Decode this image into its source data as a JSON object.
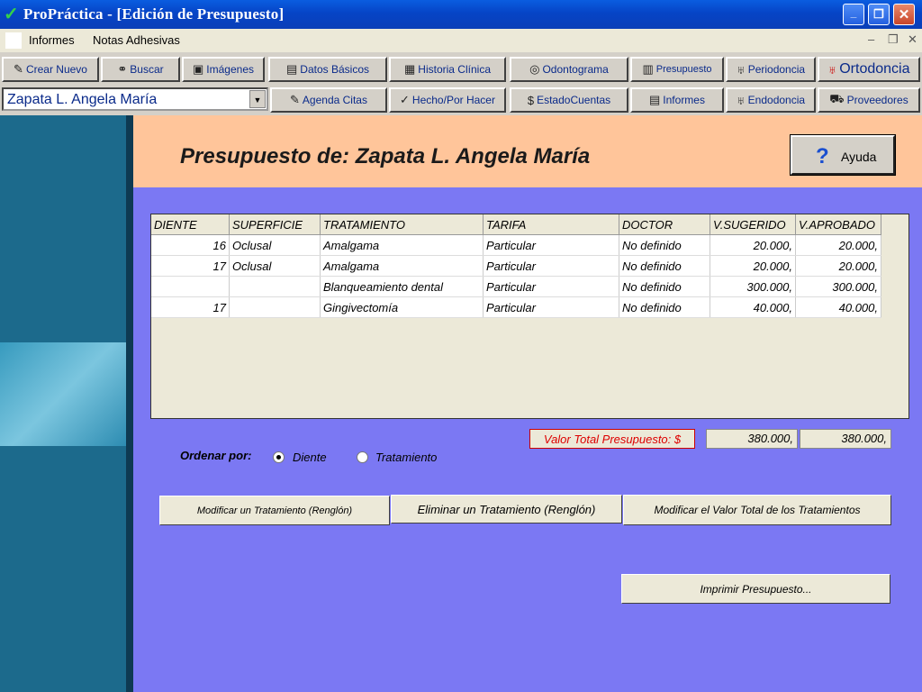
{
  "window": {
    "title": "ProPráctica - [Edición de Presupuesto]"
  },
  "menu": {
    "items": [
      "Informes",
      "Notas Adhesivas"
    ]
  },
  "toolbar": {
    "row1": [
      "Crear Nuevo",
      "Buscar",
      "Imágenes",
      "Datos Básicos",
      "Historia Clínica",
      "Odontograma",
      "Presupuesto",
      "Periodoncia",
      "Ortodoncia"
    ],
    "row2": [
      "Agenda Citas",
      "Hecho/Por Hacer",
      "EstadoCuentas",
      "Informes",
      "Endodoncia",
      "Proveedores"
    ],
    "patient_selected": "Zapata L. Angela María"
  },
  "header": {
    "title": "Presupuesto de: Zapata L. Angela María",
    "help_label": "Ayuda"
  },
  "table": {
    "columns": [
      "DIENTE",
      "SUPERFICIE",
      "TRATAMIENTO",
      "TARIFA",
      "DOCTOR",
      "V.SUGERIDO",
      "V.APROBADO"
    ],
    "rows": [
      [
        "16",
        "Oclusal",
        "Amalgama",
        "Particular",
        "No definido",
        "20.000,",
        "20.000,"
      ],
      [
        "17",
        "Oclusal",
        "Amalgama",
        "Particular",
        "No definido",
        "20.000,",
        "20.000,"
      ],
      [
        "",
        "",
        "Blanqueamiento dental",
        "Particular",
        "No definido",
        "300.000,",
        "300.000,"
      ],
      [
        "17",
        "",
        "Gingivectomía",
        "Particular",
        "No definido",
        "40.000,",
        "40.000,"
      ]
    ]
  },
  "totals": {
    "label": "Valor Total Presupuesto: $",
    "suggested": "380.000,",
    "approved": "380.000,"
  },
  "sort": {
    "label": "Ordenar por:",
    "options": [
      "Diente",
      "Tratamiento"
    ],
    "selected": "Diente"
  },
  "actions": {
    "modify_row": "Modificar un Tratamiento (Renglón)",
    "delete_row": "Eliminar un Tratamiento (Renglón)",
    "modify_total": "Modificar el Valor Total de los Tratamientos",
    "print": "Imprimir Presupuesto..."
  },
  "colors": {
    "content_bg": "#7b78f3",
    "header_bg": "#ffc59a",
    "left_panel": "#1c6a8c",
    "total_label": "#dd0000"
  }
}
